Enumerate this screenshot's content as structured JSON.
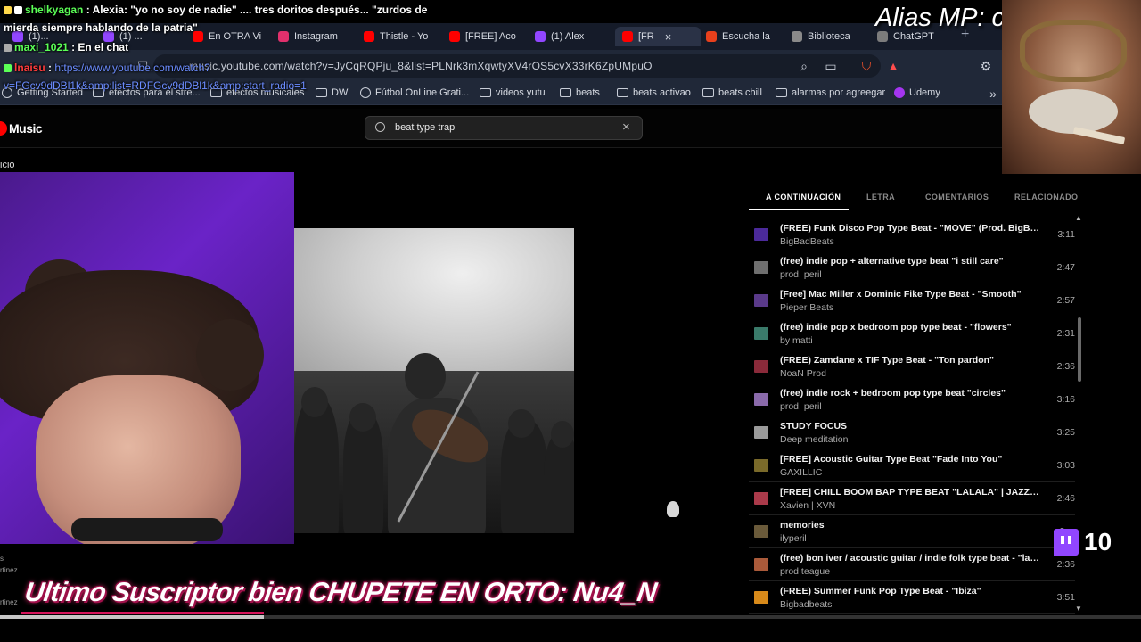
{
  "browser": {
    "tabs": [
      {
        "label": "(1)...",
        "color": "#9146ff"
      },
      {
        "label": "(1) ...",
        "color": "#9146ff"
      },
      {
        "label": "En OTRA Vi",
        "color": "#ff0000"
      },
      {
        "label": "Instagram",
        "color": "#e1306c"
      },
      {
        "label": "Thistle - Yo",
        "color": "#ff0000"
      },
      {
        "label": "[FREE] Aco",
        "color": "#ff0000"
      },
      {
        "label": "(1) Alex",
        "color": "#9146ff"
      },
      {
        "label": "[FR",
        "color": "#ff0000"
      },
      {
        "label": "Escucha la",
        "color": "#e8401c"
      },
      {
        "label": "Biblioteca",
        "color": "#8a8a8a"
      },
      {
        "label": "ChatGPT",
        "color": "#7c7c7c"
      }
    ],
    "url": "music.youtube.com/watch?v=JyCqRQPju_8&list=PLNrk3mXqwtyXV4rOS5cvX33rK6ZpUMpuO",
    "bookmarks": [
      {
        "label": "Getting Started",
        "icon": "firefox-icon"
      },
      {
        "label": "efectos para el stre...",
        "icon": "folder-icon"
      },
      {
        "label": "efectos musicales",
        "icon": "folder-icon"
      },
      {
        "label": "DW",
        "icon": "folder-icon"
      },
      {
        "label": "Fútbol OnLine Grati...",
        "icon": "globe-icon"
      },
      {
        "label": "videos yutu",
        "icon": "folder-icon"
      },
      {
        "label": "beats",
        "icon": "folder-icon"
      },
      {
        "label": "beats activao",
        "icon": "folder-icon"
      },
      {
        "label": "beats chill",
        "icon": "folder-icon"
      },
      {
        "label": "alarmas por agreegar",
        "icon": "folder-icon"
      },
      {
        "label": "Udemy",
        "icon": "udemy-icon"
      }
    ]
  },
  "ytmusic": {
    "logo": "Music",
    "search_value": "beat type trap",
    "nav_home": "icio",
    "queue_tabs": [
      "A CONTINUACIÓN",
      "LETRA",
      "COMENTARIOS",
      "RELACIONADO"
    ],
    "queue": [
      {
        "title": "(FREE) Funk Disco Pop Type Beat - \"MOVE\" (Prod. BigBadBe...",
        "artist": "BigBadBeats",
        "duration": "3:11",
        "thumb": "#4b2a9a"
      },
      {
        "title": "(free) indie pop + alternative type beat \"i still care\"",
        "artist": "prod. peril",
        "duration": "2:47",
        "thumb": "#6f6f6f"
      },
      {
        "title": "[Free] Mac Miller x Dominic Fike Type Beat - \"Smooth\"",
        "artist": "Pieper Beats",
        "duration": "2:57",
        "thumb": "#5a3a8a"
      },
      {
        "title": "(free) indie pop x bedroom pop type beat - \"flowers\"",
        "artist": "by matti",
        "duration": "2:31",
        "thumb": "#3a7a6a"
      },
      {
        "title": "(FREE) Zamdane x TIF Type Beat - \"Ton pardon\"",
        "artist": "NoaN Prod",
        "duration": "2:36",
        "thumb": "#8a2a3a"
      },
      {
        "title": "(free) indie rock + bedroom pop type beat \"circles\"",
        "artist": "prod. peril",
        "duration": "3:16",
        "thumb": "#8a6aaa"
      },
      {
        "title": "STUDY FOCUS",
        "artist": "Deep meditation",
        "duration": "3:25",
        "thumb": "#9a9a9a"
      },
      {
        "title": "[FREE] Acoustic Guitar Type Beat \"Fade Into You\"",
        "artist": "GAXILLIC",
        "duration": "3:03",
        "thumb": "#7a6a2a"
      },
      {
        "title": "[FREE] CHILL BOOM BAP TYPE BEAT \"LALALA\" | JAZZ TYPE ...",
        "artist": "Xavien | XVN",
        "duration": "2:46",
        "thumb": "#aa3a4a"
      },
      {
        "title": "memories",
        "artist": "ilyperil",
        "duration": "2:...",
        "thumb": "#6a5a3a"
      },
      {
        "title": "(free) bon iver / acoustic guitar / indie folk type beat - \"layin...",
        "artist": "prod teague",
        "duration": "2:36",
        "thumb": "#aa5a3a"
      },
      {
        "title": "(FREE) Summer Funk Pop Type Beat - \"Ibiza\"",
        "artist": "Bigbadbeats",
        "duration": "3:51",
        "thumb": "#d88a1a"
      }
    ]
  },
  "chat": [
    {
      "user": "shelkyagan",
      "message": "Alexia: \"yo no soy de nadie\" .... tres doritos después... \"zurdos de"
    },
    {
      "user": "",
      "message": "mierda siempre hablando de la patria\""
    },
    {
      "user": "maxi_1021",
      "message": "En el chat"
    },
    {
      "user": "lnaisu",
      "message": "https://www.youtube.com/watch?"
    },
    {
      "user": "",
      "message": "v=FGcv9dDBl1k&amp;list=RDFGcv9dDBl1k&amp;start_radio=1"
    }
  ],
  "overlay": {
    "alias": "Alias MP: c",
    "subscriber_banner": "Ultimo Suscriptor bien CHUPETE EN ORTO: Nu4_N",
    "twitch_count": "10",
    "side_label_1": "s",
    "side_label_2": "rtinez",
    "side_label_3": "rtinez"
  }
}
